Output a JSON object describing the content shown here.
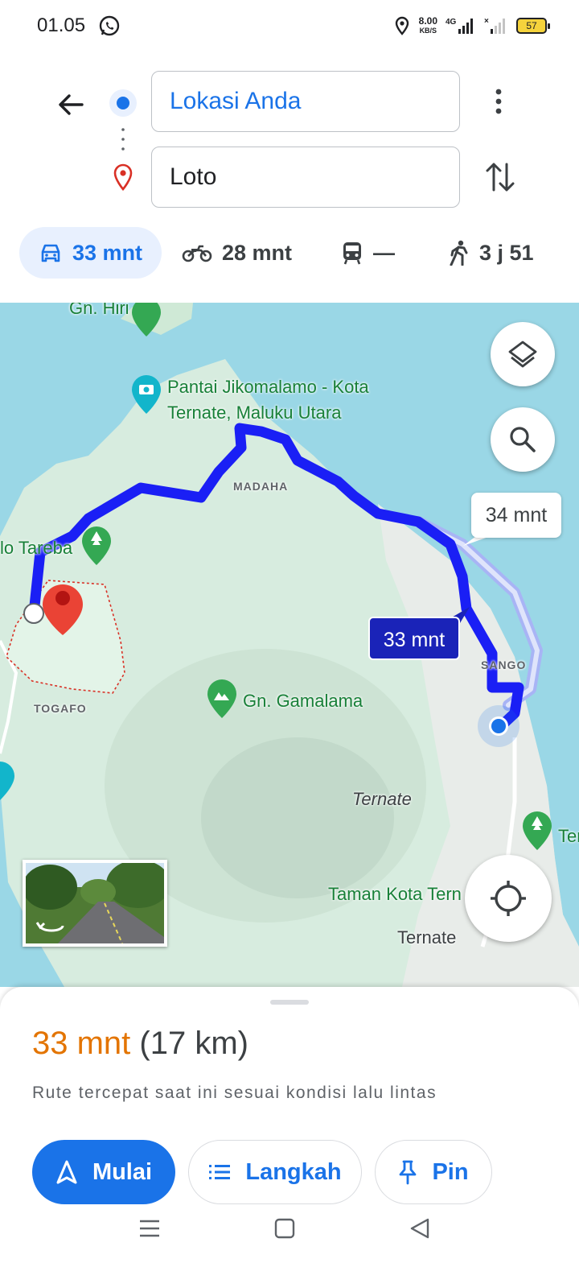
{
  "status_bar": {
    "time": "01.05",
    "net_speed": "8.00",
    "net_unit": "KB/S",
    "battery": "57"
  },
  "directions": {
    "origin": "Lokasi Anda",
    "destination": "Loto",
    "modes": [
      {
        "icon": "car-icon",
        "label": "33 mnt",
        "active": true
      },
      {
        "icon": "motorcycle-icon",
        "label": "28 mnt",
        "active": false
      },
      {
        "icon": "transit-icon",
        "label": "—",
        "active": false
      },
      {
        "icon": "walk-icon",
        "label": "3 j 51",
        "active": false
      }
    ]
  },
  "map": {
    "labels": {
      "gn_hiri": "Gn. Hiri",
      "pantai_1": "Pantai Jikomalamo - Kota",
      "pantai_2": "Ternate, Maluku Utara",
      "madaha": "MADAHA",
      "tareba": "lo Tareba",
      "togafo": "TOGAFO",
      "gamalama": "Gn. Gamalama",
      "sango": "SANGO",
      "ternate_italic": "Ternate",
      "taman_kota": "Taman Kota Tern",
      "ternate_city": "Ternate",
      "ter_edge": "Ter"
    },
    "route_alt_time": "34 mnt",
    "route_main_time": "33 mnt",
    "colors": {
      "route": "#1a1ff5",
      "alt_route": "#a8b4f5",
      "water": "#9ad7e6",
      "land": "#d7ecdf"
    }
  },
  "sheet": {
    "duration": "33 mnt",
    "distance": "(17 km)",
    "note": "Rute tercepat saat ini sesuai kondisi lalu lintas",
    "start_label": "Mulai",
    "steps_label": "Langkah",
    "pin_label": "Pin"
  }
}
